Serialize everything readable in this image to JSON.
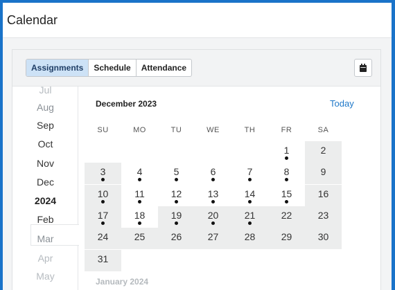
{
  "header": {
    "title": "Calendar"
  },
  "toolbar": {
    "tabs": [
      {
        "label": "Assignments",
        "active": true
      },
      {
        "label": "Schedule",
        "active": false
      },
      {
        "label": "Attendance",
        "active": false
      }
    ],
    "calendar_button_icon": "calendar-icon"
  },
  "month_list": [
    {
      "label": "Jul",
      "style": "faded"
    },
    {
      "label": "Aug",
      "style": "semi"
    },
    {
      "label": "Sep",
      "style": "normal"
    },
    {
      "label": "Oct",
      "style": "normal"
    },
    {
      "label": "Nov",
      "style": "normal"
    },
    {
      "label": "Dec",
      "style": "current"
    },
    {
      "label": "2024",
      "style": "year"
    },
    {
      "label": "Feb",
      "style": "normal"
    },
    {
      "label": "Mar",
      "style": "semi"
    },
    {
      "label": "Apr",
      "style": "faded"
    },
    {
      "label": "May",
      "style": "faded"
    }
  ],
  "calendar": {
    "month_title": "December 2023",
    "today_label": "Today",
    "weekdays": [
      "SU",
      "MO",
      "TU",
      "WE",
      "TH",
      "FR",
      "SA"
    ],
    "next_month_title": "January 2024",
    "days": [
      {
        "n": "1",
        "dot": true,
        "grey": false
      },
      {
        "n": "2",
        "dot": false,
        "grey": true
      },
      {
        "n": "3",
        "dot": true,
        "grey": true
      },
      {
        "n": "4",
        "dot": true,
        "grey": false
      },
      {
        "n": "5",
        "dot": true,
        "grey": false
      },
      {
        "n": "6",
        "dot": true,
        "grey": false
      },
      {
        "n": "7",
        "dot": true,
        "grey": false
      },
      {
        "n": "8",
        "dot": true,
        "grey": false
      },
      {
        "n": "9",
        "dot": false,
        "grey": true
      },
      {
        "n": "10",
        "dot": true,
        "grey": true
      },
      {
        "n": "11",
        "dot": true,
        "grey": false
      },
      {
        "n": "12",
        "dot": true,
        "grey": false
      },
      {
        "n": "13",
        "dot": true,
        "grey": false
      },
      {
        "n": "14",
        "dot": true,
        "grey": false
      },
      {
        "n": "15",
        "dot": true,
        "grey": false
      },
      {
        "n": "16",
        "dot": false,
        "grey": true
      },
      {
        "n": "17",
        "dot": true,
        "grey": true
      },
      {
        "n": "18",
        "dot": true,
        "grey": false
      },
      {
        "n": "19",
        "dot": true,
        "grey": true
      },
      {
        "n": "20",
        "dot": true,
        "grey": true
      },
      {
        "n": "21",
        "dot": true,
        "grey": true
      },
      {
        "n": "22",
        "dot": false,
        "grey": true
      },
      {
        "n": "23",
        "dot": false,
        "grey": true
      },
      {
        "n": "24",
        "dot": false,
        "grey": true
      },
      {
        "n": "25",
        "dot": false,
        "grey": true
      },
      {
        "n": "26",
        "dot": false,
        "grey": true
      },
      {
        "n": "27",
        "dot": false,
        "grey": true
      },
      {
        "n": "28",
        "dot": false,
        "grey": true
      },
      {
        "n": "29",
        "dot": false,
        "grey": true
      },
      {
        "n": "30",
        "dot": false,
        "grey": true
      },
      {
        "n": "31",
        "dot": false,
        "grey": true
      }
    ]
  }
}
